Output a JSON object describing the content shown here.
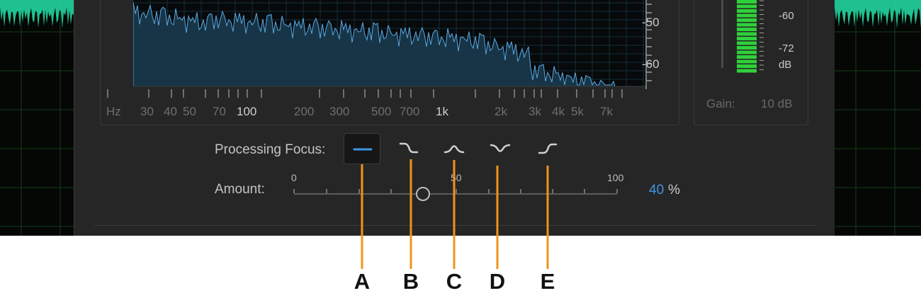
{
  "spectrum": {
    "frequency_labels": [
      "Hz",
      "30",
      "40",
      "50",
      "70",
      "100",
      "200",
      "300",
      "500",
      "700",
      "1k",
      "2k",
      "3k",
      "4k",
      "5k",
      "7k"
    ],
    "db_labels": [
      "-50",
      "-60"
    ]
  },
  "meter": {
    "db_labels": [
      "-60",
      "-72",
      "dB"
    ],
    "gain_label": "Gain:",
    "gain_value": "10 dB"
  },
  "processing_focus": {
    "label": "Processing Focus:",
    "buttons": [
      {
        "callout": "A",
        "icon": "flat-line-icon",
        "selected": true
      },
      {
        "callout": "B",
        "icon": "low-emphasis-icon",
        "selected": false
      },
      {
        "callout": "C",
        "icon": "mid-emphasis-icon",
        "selected": false
      },
      {
        "callout": "D",
        "icon": "low-and-high-emphasis-icon",
        "selected": false
      },
      {
        "callout": "E",
        "icon": "high-emphasis-icon",
        "selected": false
      }
    ]
  },
  "amount": {
    "label": "Amount:",
    "scale_min": "0",
    "scale_mid": "50",
    "scale_max": "100",
    "value": "40",
    "value_fraction": 0.4,
    "unit": "%"
  },
  "colors": {
    "accent_blue": "#3d95e4",
    "callout_orange": "#f0931d",
    "meter_green": "#2fd13b",
    "waveform_green": "#22d6a0"
  }
}
